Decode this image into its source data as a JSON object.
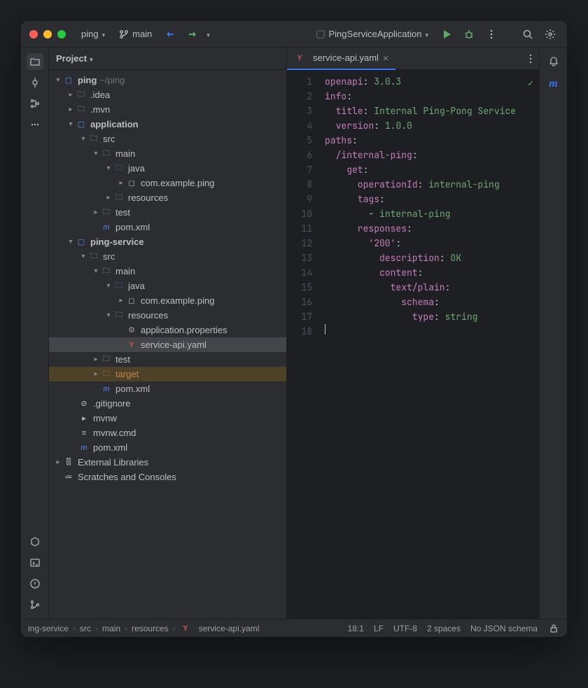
{
  "titlebar": {
    "project": "ping",
    "branch": "main",
    "runConfig": "PingServiceApplication"
  },
  "panel": {
    "title": "Project"
  },
  "tree": {
    "root": {
      "name": "ping",
      "hint": "~/ping"
    },
    "idea": ".idea",
    "mvn": ".mvn",
    "application": "application",
    "src": "src",
    "main": "main",
    "java": "java",
    "pkgPing": "com.example.ping",
    "resources": "resources",
    "test": "test",
    "pomxml": "pom.xml",
    "pingService": "ping-service",
    "appProps": "application.properties",
    "serviceApi": "service-api.yaml",
    "target": "target",
    "gitignore": ".gitignore",
    "mvnw": "mvnw",
    "mvnwCmd": "mvnw.cmd",
    "extLibs": "External Libraries",
    "scratches": "Scratches and Consoles"
  },
  "tab": {
    "label": "service-api.yaml"
  },
  "code": {
    "l1a": "openapi",
    "l1b": ": ",
    "l1c": "3.0.3",
    "l2a": "info",
    "l2b": ":",
    "l3a": "  title",
    "l3b": ": ",
    "l3c": "Internal Ping-Pong Service",
    "l4a": "  version",
    "l4b": ": ",
    "l4c": "1.0.0",
    "l5a": "paths",
    "l5b": ":",
    "l6a": "  /internal-ping",
    "l6b": ":",
    "l7a": "    get",
    "l7b": ":",
    "l8a": "      operationId",
    "l8b": ": ",
    "l8c": "internal-ping",
    "l9a": "      tags",
    "l9b": ":",
    "l10a": "        - ",
    "l10b": "internal-ping",
    "l11a": "      responses",
    "l11b": ":",
    "l12a": "        '200'",
    "l12b": ":",
    "l13a": "          description",
    "l13b": ": ",
    "l13c": "OK",
    "l14a": "          content",
    "l14b": ":",
    "l15a": "            text/plain",
    "l15b": ":",
    "l16a": "              schema",
    "l16b": ":",
    "l17a": "                type",
    "l17b": ": ",
    "l17c": "string",
    "lineNumbers": [
      "1",
      "2",
      "3",
      "4",
      "5",
      "6",
      "7",
      "8",
      "9",
      "10",
      "11",
      "12",
      "13",
      "14",
      "15",
      "16",
      "17",
      "18"
    ]
  },
  "statusbar": {
    "bc1": "ing-service",
    "bc2": "src",
    "bc3": "main",
    "bc4": "resources",
    "bc5": "service-api.yaml",
    "pos": "18:1",
    "lineEnding": "LF",
    "encoding": "UTF-8",
    "indent": "2 spaces",
    "schema": "No JSON schema"
  }
}
